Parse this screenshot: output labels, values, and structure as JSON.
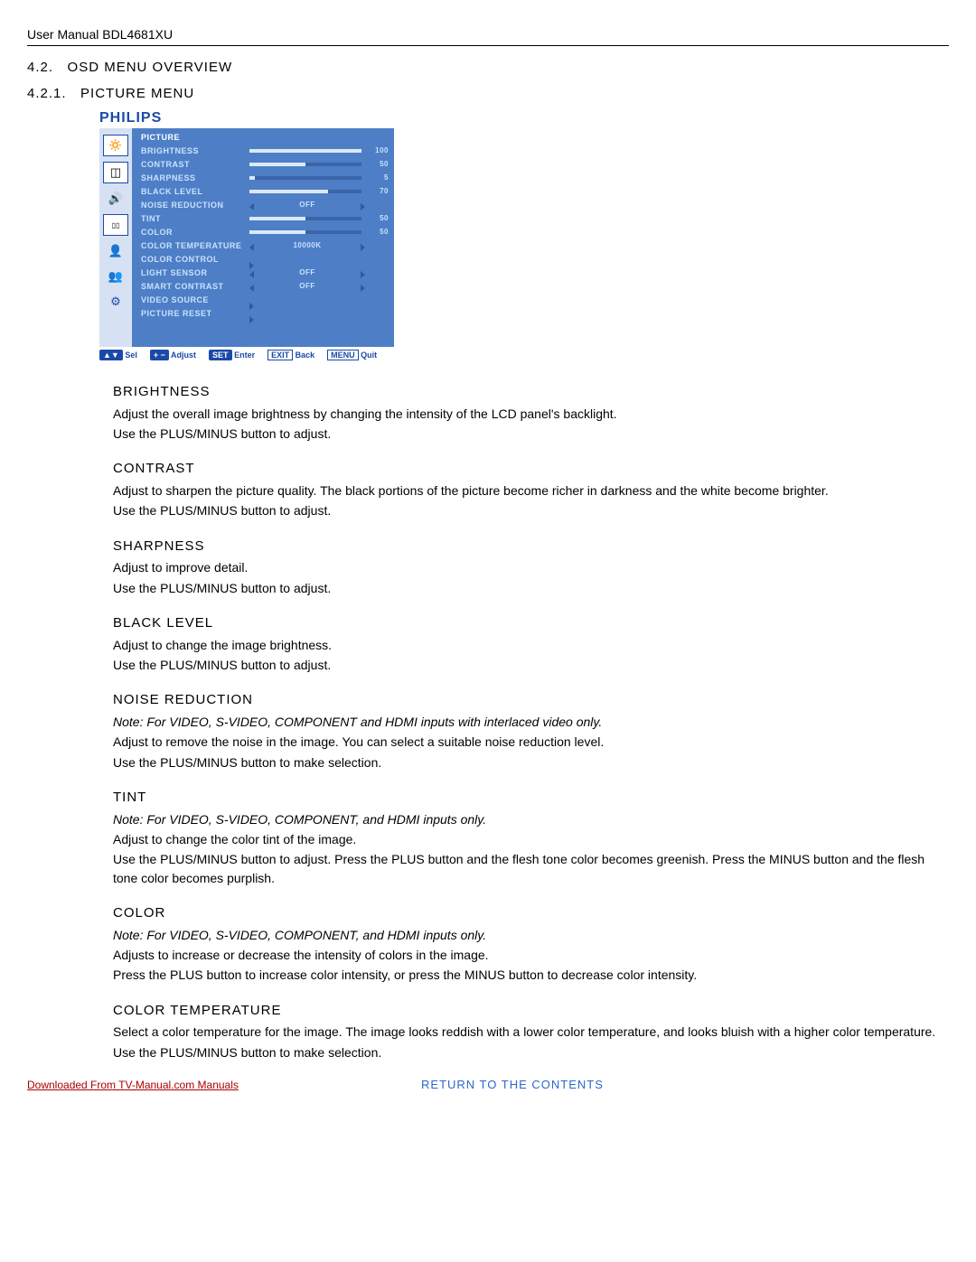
{
  "header": {
    "title": "User Manual BDL4681XU"
  },
  "section": {
    "num": "4.2.",
    "title": "OSD MENU OVERVIEW"
  },
  "subsection": {
    "num": "4.2.1.",
    "title": "PICTURE MENU"
  },
  "brand": "PHILIPS",
  "menu": {
    "heading": "PICTURE",
    "items": [
      {
        "label": "BRIGHTNESS",
        "type": "bar",
        "value": 100,
        "max": 100
      },
      {
        "label": "CONTRAST",
        "type": "bar",
        "value": 50,
        "max": 100
      },
      {
        "label": "SHARPNESS",
        "type": "bar",
        "value": 5,
        "max": 100
      },
      {
        "label": "BLACK LEVEL",
        "type": "bar",
        "value": 70,
        "max": 100
      },
      {
        "label": "NOISE REDUCTION",
        "type": "select",
        "value": "OFF"
      },
      {
        "label": "TINT",
        "type": "bar",
        "value": 50,
        "max": 100
      },
      {
        "label": "COLOR",
        "type": "bar",
        "value": 50,
        "max": 100
      },
      {
        "label": "COLOR TEMPERATURE",
        "type": "select",
        "value": "10000K"
      },
      {
        "label": "COLOR CONTROL",
        "type": "sub"
      },
      {
        "label": "LIGHT SENSOR",
        "type": "select",
        "value": "OFF"
      },
      {
        "label": "SMART CONTRAST",
        "type": "select",
        "value": "OFF"
      },
      {
        "label": "VIDEO SOURCE",
        "type": "sub"
      },
      {
        "label": "PICTURE RESET",
        "type": "sub"
      }
    ]
  },
  "hints": {
    "sel": "Sel",
    "adjust": "Adjust",
    "enter": "Enter",
    "back": "Back",
    "quit": "Quit",
    "set_btn": "SET",
    "exit_btn": "EXIT",
    "menu_btn": "MENU"
  },
  "entries": [
    {
      "title": "BRIGHTNESS",
      "lines": [
        "Adjust the overall image brightness by changing the intensity of the LCD panel's backlight.",
        "Use the PLUS/MINUS button to adjust."
      ]
    },
    {
      "title": "CONTRAST",
      "lines": [
        "Adjust to sharpen the picture quality. The black portions of the picture become richer in darkness and the white become brighter.",
        "Use the PLUS/MINUS button to adjust."
      ]
    },
    {
      "title": "SHARPNESS",
      "lines": [
        "Adjust to improve detail.",
        "Use the PLUS/MINUS button to adjust."
      ]
    },
    {
      "title": "BLACK LEVEL",
      "lines": [
        "Adjust to change the image brightness.",
        "Use the PLUS/MINUS button to adjust."
      ]
    },
    {
      "title": "NOISE REDUCTION",
      "note": "Note: For VIDEO, S-VIDEO, COMPONENT and HDMI inputs with interlaced video only.",
      "lines": [
        "Adjust to remove the noise in the image. You can select a suitable noise reduction level.",
        "Use the PLUS/MINUS button to make selection."
      ]
    },
    {
      "title": "TINT",
      "note": "Note: For VIDEO, S-VIDEO, COMPONENT, and HDMI inputs only.",
      "lines": [
        "Adjust to change the color tint of the image.",
        "Use the PLUS/MINUS button to adjust. Press the PLUS button and the flesh tone color becomes greenish. Press the MINUS button and the flesh tone color becomes purplish."
      ]
    },
    {
      "title": "COLOR",
      "note": "Note: For VIDEO, S-VIDEO, COMPONENT, and HDMI inputs only.",
      "lines": [
        "Adjusts to increase or decrease the intensity of colors in the image.",
        "Press the PLUS button to increase color intensity, or press the MINUS button to decrease color intensity."
      ]
    },
    {
      "title": "COLOR TEMPERATURE",
      "lines": [
        "Select a color temperature for the image. The image looks reddish with a lower color temperature, and looks bluish with a higher color temperature.",
        "Use the PLUS/MINUS button to make selection."
      ]
    }
  ],
  "footer": {
    "download": "Downloaded From TV-Manual.com Manuals",
    "return": "RETURN TO THE CONTENTS"
  }
}
